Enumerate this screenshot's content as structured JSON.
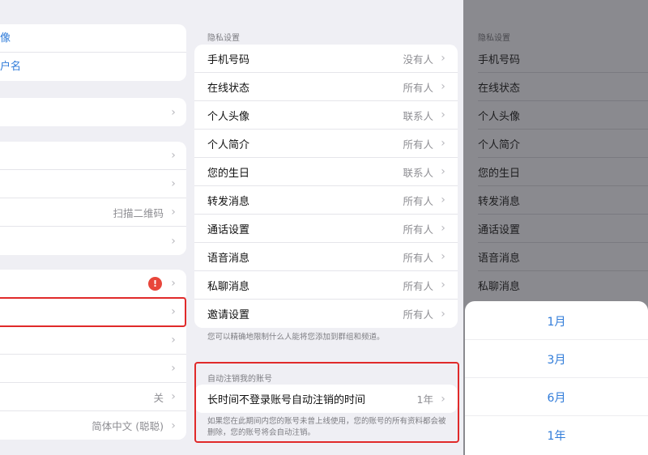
{
  "left": {
    "group1": [
      {
        "label": "像"
      },
      {
        "label": "户名"
      }
    ],
    "group2_value": "",
    "group3": [
      {
        "value": ""
      },
      {
        "value": ""
      },
      {
        "value": "扫描二维码"
      },
      {
        "value": ""
      }
    ],
    "group4": [
      {
        "value": "",
        "badge": "!"
      },
      {
        "value": ""
      },
      {
        "value": ""
      },
      {
        "value": ""
      },
      {
        "value": "关"
      },
      {
        "value": "简体中文 (聪聪)"
      }
    ]
  },
  "middle": {
    "privacy_title": "隐私设置",
    "privacy_rows": [
      {
        "label": "手机号码",
        "value": "没有人"
      },
      {
        "label": "在线状态",
        "value": "所有人"
      },
      {
        "label": "个人头像",
        "value": "联系人"
      },
      {
        "label": "个人简介",
        "value": "所有人"
      },
      {
        "label": "您的生日",
        "value": "联系人"
      },
      {
        "label": "转发消息",
        "value": "所有人"
      },
      {
        "label": "通话设置",
        "value": "所有人"
      },
      {
        "label": "语音消息",
        "value": "所有人"
      },
      {
        "label": "私聊消息",
        "value": "所有人"
      },
      {
        "label": "邀请设置",
        "value": "所有人"
      }
    ],
    "privacy_note": "您可以精确地限制什么人能将您添加到群组和频道。",
    "auto_delete_title": "自动注销我的账号",
    "auto_delete_row": {
      "label": "长时间不登录账号自动注销的时间",
      "value": "1年"
    },
    "auto_delete_note": "如果您在此期间内您的账号未曾上线使用，您的账号的所有资料都会被删除，您的账号将会自动注销。"
  },
  "right": {
    "title": "隐私设置",
    "rows": [
      "手机号码",
      "在线状态",
      "个人头像",
      "个人简介",
      "您的生日",
      "转发消息",
      "通话设置",
      "语音消息",
      "私聊消息"
    ],
    "options": [
      "1月",
      "3月",
      "6月",
      "1年"
    ]
  },
  "colors": {
    "accent": "#2f7bd9",
    "highlight": "#e02a2a",
    "badge": "#e8463b"
  }
}
